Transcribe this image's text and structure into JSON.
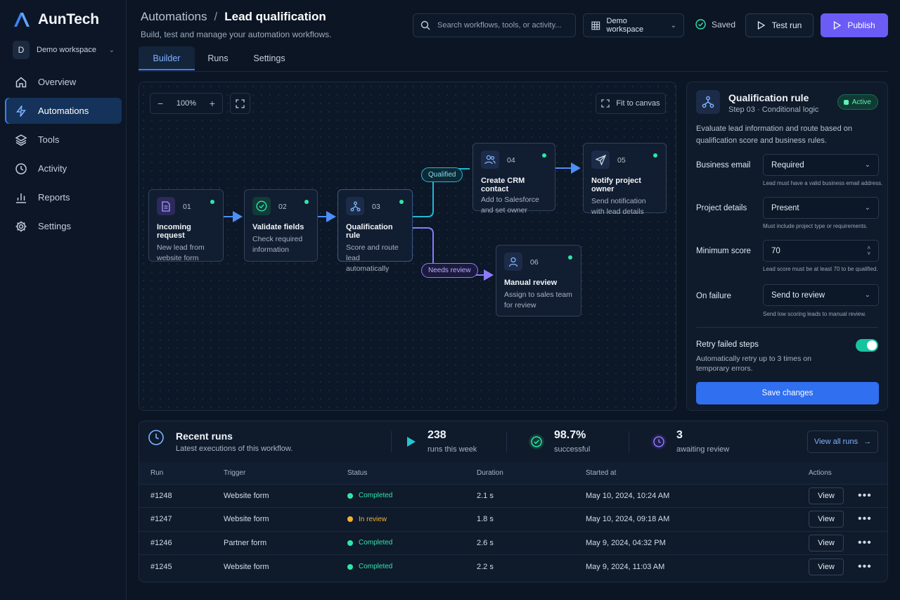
{
  "app": {
    "name": "AunTech"
  },
  "workspace": {
    "initial": "D",
    "name": "Demo workspace"
  },
  "nav": [
    {
      "label": "Overview",
      "icon": "home-icon",
      "active": false
    },
    {
      "label": "Automations",
      "icon": "lightning-icon",
      "active": true
    },
    {
      "label": "Tools",
      "icon": "layers-icon",
      "active": false
    },
    {
      "label": "Activity",
      "icon": "clock-icon",
      "active": false
    },
    {
      "label": "Reports",
      "icon": "bar-chart-icon",
      "active": false
    },
    {
      "label": "Settings",
      "icon": "gear-icon",
      "active": false
    }
  ],
  "header": {
    "crumb_parent": "Automations",
    "crumb_sep": "/",
    "crumb_current": "Lead qualification",
    "subtitle": "Build, test and manage your automation workflows.",
    "search_placeholder": "Search workflows, tools, or activity...",
    "workspace_select": "Demo workspace",
    "saved": "Saved",
    "test_run": "Test run",
    "publish": "Publish"
  },
  "tabs": [
    "Builder",
    "Runs",
    "Settings"
  ],
  "canvas": {
    "zoom": "100%",
    "zoom_out": "−",
    "zoom_in": "+",
    "fit": "Fit to canvas",
    "nodes": [
      {
        "num": "01",
        "title": "Incoming request",
        "desc1": "New lead from",
        "desc2": "website form",
        "icon": "document-icon"
      },
      {
        "num": "02",
        "title": "Validate fields",
        "desc1": "Check required",
        "desc2": "information",
        "icon": "check-circle-icon"
      },
      {
        "num": "03",
        "title": "Qualification rule",
        "desc1": "Score and route",
        "desc2": "lead automatically",
        "icon": "branch-icon"
      },
      {
        "num": "04",
        "title": "Create CRM contact",
        "desc1": "Add to Salesforce",
        "desc2": "and set owner",
        "icon": "users-icon"
      },
      {
        "num": "05",
        "title": "Notify project owner",
        "desc1": "Send notification",
        "desc2": "with lead details",
        "icon": "send-icon"
      },
      {
        "num": "06",
        "title": "Manual review",
        "desc1": "Assign to sales team",
        "desc2": "for review",
        "icon": "user-icon"
      }
    ],
    "edge_qualified": "Qualified",
    "edge_review": "Needs review"
  },
  "panel": {
    "title": "Qualification rule",
    "subtitle": "Step 03 · Conditional logic",
    "badge": "Active",
    "description": "Evaluate lead information and route based on qualification score and business rules.",
    "fields": [
      {
        "label": "Business email",
        "value": "Required",
        "hint": "Lead must have a valid business email address."
      },
      {
        "label": "Project details",
        "value": "Present",
        "hint": "Must include project type or requirements."
      },
      {
        "label": "Minimum score",
        "value": "70",
        "hint": "Lead score must be at least 70 to be qualified."
      },
      {
        "label": "On failure",
        "value": "Send to review",
        "hint": "Send low scoring leads to manual review."
      }
    ],
    "retry_label": "Retry failed steps",
    "retry_desc": "Automatically retry up to 3 times on temporary errors.",
    "save": "Save changes"
  },
  "runs": {
    "title": "Recent runs",
    "subtitle": "Latest executions of this workflow.",
    "stats": [
      {
        "value": "238",
        "label": "runs this week"
      },
      {
        "value": "98.7%",
        "label": "successful"
      },
      {
        "value": "3",
        "label": "awaiting review"
      }
    ],
    "view_all": "View all runs",
    "columns": [
      "Run",
      "Trigger",
      "Status",
      "Duration",
      "Started at",
      "Actions"
    ],
    "rows": [
      {
        "run": "#1248",
        "trigger": "Website form",
        "status": "Completed",
        "duration": "2.1 s",
        "started": "May 10, 2024, 10:24 AM"
      },
      {
        "run": "#1247",
        "trigger": "Website form",
        "status": "In review",
        "duration": "1.8 s",
        "started": "May 10, 2024, 09:18 AM"
      },
      {
        "run": "#1246",
        "trigger": "Partner form",
        "status": "Completed",
        "duration": "2.6 s",
        "started": "May 9, 2024, 04:32 PM"
      },
      {
        "run": "#1245",
        "trigger": "Website form",
        "status": "Completed",
        "duration": "2.2 s",
        "started": "May 9, 2024, 11:03 AM"
      }
    ],
    "view_label": "View",
    "more_label": "•••"
  },
  "colors": {
    "accent": "#3b82f6",
    "publish": "#6a5cf5",
    "success": "#2ee6a8",
    "warning": "#f2b233",
    "review": "#8b7bff"
  }
}
